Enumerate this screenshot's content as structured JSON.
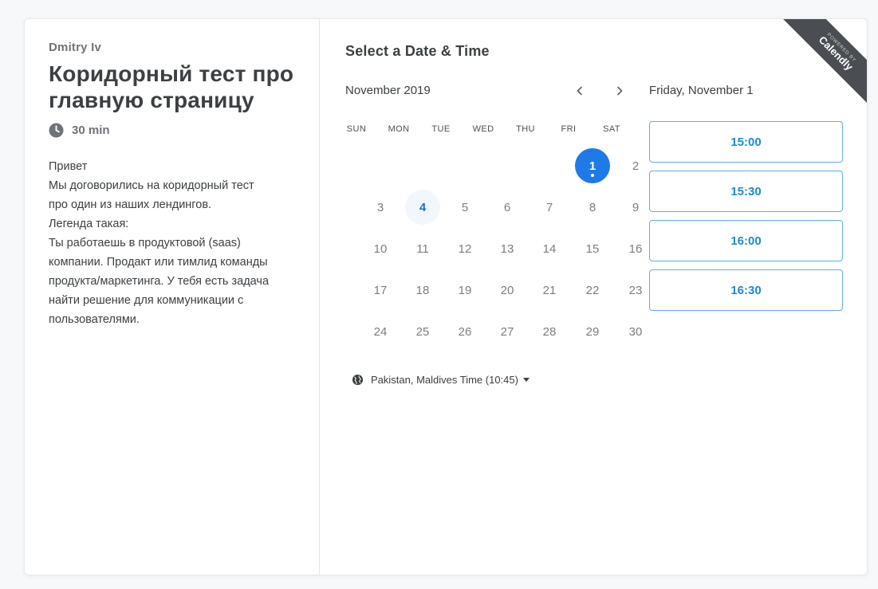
{
  "event": {
    "host_name": "Dmitry Iv",
    "title_line1": "Коридорный тест про",
    "title_line2": "главную страницу",
    "duration": "30 min",
    "description_lines": [
      "Привет",
      "Мы договорились на коридорный тест",
      "про один из наших лендингов.",
      "Легенда такая:",
      "Ты работаешь в продуктовой (saas)",
      "компании. Продакт или тимлид команды",
      "продукта/маркетинга. У тебя есть задача",
      "найти решение для коммуникации с",
      "пользователями."
    ]
  },
  "scheduler": {
    "title": "Select a Date & Time",
    "month_label": "November 2019",
    "prev_icon": "chevron-left-icon",
    "next_icon": "chevron-right-icon",
    "weekdays": [
      "SUN",
      "MON",
      "TUE",
      "WED",
      "THU",
      "FRI",
      "SAT"
    ],
    "days": {
      "d1": "1",
      "d2": "2",
      "d3": "3",
      "d4": "4",
      "d5": "5",
      "d6": "6",
      "d7": "7",
      "d8": "8",
      "d9": "9",
      "d10": "10",
      "d11": "11",
      "d12": "12",
      "d13": "13",
      "d14": "14",
      "d15": "15",
      "d16": "16",
      "d17": "17",
      "d18": "18",
      "d19": "19",
      "d20": "20",
      "d21": "21",
      "d22": "22",
      "d23": "23",
      "d24": "24",
      "d25": "25",
      "d26": "26",
      "d27": "27",
      "d28": "28",
      "d29": "29",
      "d30": "30"
    },
    "selected_day": "1",
    "available_days": [
      "1",
      "4"
    ],
    "timezone": "Pakistan, Maldives Time (10:45)"
  },
  "slots": {
    "selected_date": "Friday, November 1",
    "times": [
      "15:00",
      "15:30",
      "16:00",
      "16:30"
    ]
  },
  "badge": {
    "small_text": "POWERED BY",
    "brand": "Calendly"
  },
  "colors": {
    "accent": "#1f7ae8",
    "slot_border": "#5fb0e8",
    "slot_text": "#1d8ad4",
    "ribbon": "#4a4d52"
  }
}
